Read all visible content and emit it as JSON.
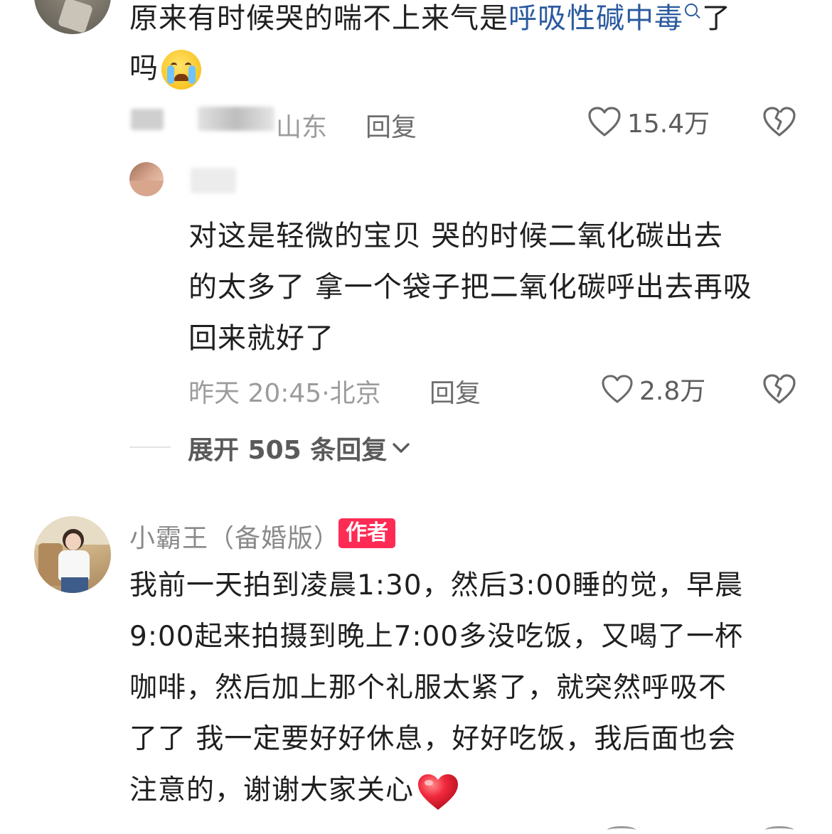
{
  "comment1": {
    "text_before_link": "原来有时候哭的喘不上来气是",
    "link_text": "呼吸性碱中毒",
    "text_after_link": "了",
    "text_line2": "吗",
    "location": "山东",
    "reply_label": "回复",
    "like_count": "15.4万"
  },
  "reply1": {
    "lines": [
      "对这是轻微的宝贝  哭的时候二氧化碳出去",
      "的太多了 拿一个袋子把二氧化碳呼出去再吸",
      "回来就好了"
    ],
    "timestamp_location": "昨天 20:45·北京",
    "reply_label": "回复",
    "like_count": "2.8万"
  },
  "expand": {
    "label": "展开 505 条回复"
  },
  "comment2": {
    "username": "小霸王（备婚版）",
    "badge": "作者",
    "lines": [
      "我前一天拍到凌晨1:30，然后3:00睡的觉，早晨",
      "9:00起来拍摄到晚上7:00多没吃饭，又喝了一杯",
      "咖啡，然后加上那个礼服太紧了，就突然呼吸不",
      "了了 我一定要好好休息，好好吃饭，我后面也会",
      "注意的，谢谢大家关心"
    ]
  },
  "colors": {
    "link": "#2b5b9e",
    "badge": "#fe2c55",
    "meta": "#9c9c9c"
  }
}
